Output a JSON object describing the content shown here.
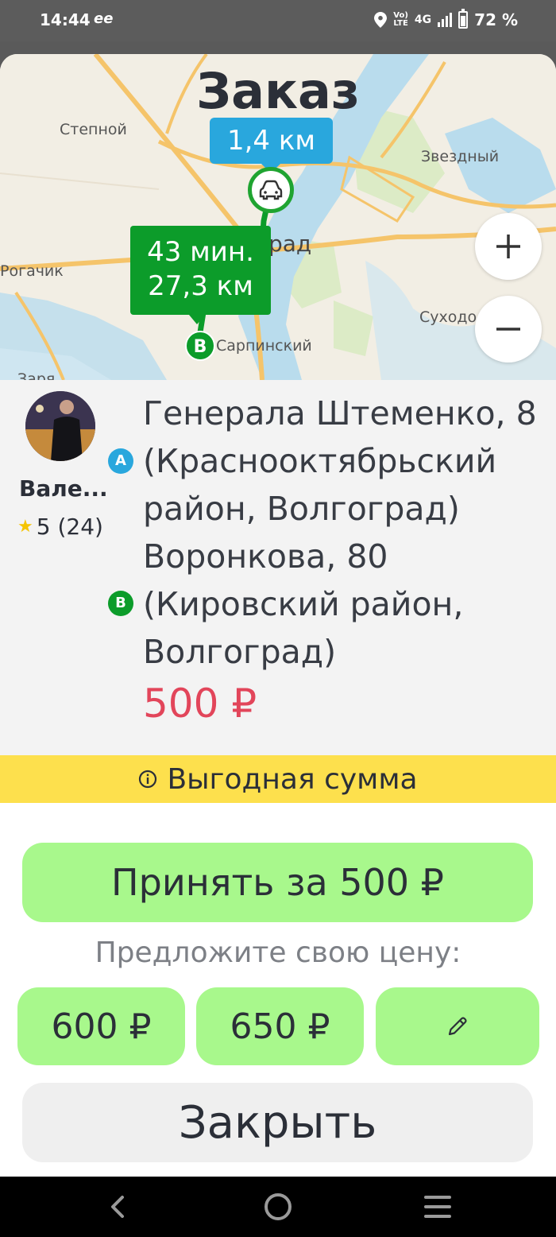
{
  "status_bar": {
    "time": "14:44",
    "app_indicator": "ee",
    "volte_top": "Vo)",
    "volte_bottom": "LTE",
    "network": "4G",
    "battery_percent": "72 %",
    "icons": [
      "location-icon",
      "volte-icon",
      "signal-icon",
      "battery-icon"
    ]
  },
  "order": {
    "title": "Заказ",
    "pickup_distance": "1,4 км",
    "trip_time": "43 мин.",
    "trip_distance": "27,3 км",
    "marker_a": "A",
    "marker_b": "B"
  },
  "map": {
    "labels": {
      "stepnoy": "Степной",
      "zvezdny": "Звездный",
      "rogachik": "Рогачик",
      "grad": "рад",
      "sukhodol": "Суходол",
      "sarpinsky": "Сарпинский",
      "zarya": "Заря"
    },
    "zoom_in_icon": "plus-icon",
    "zoom_out_icon": "minus-icon"
  },
  "driver": {
    "name": "Вале...",
    "rating": "5 (24)"
  },
  "route": {
    "from": "Генерала Штеменко, 8 (Краснооктябрьский район, Волгоград)",
    "to": "Воронкова, 80 (Кировский район, Волгоград)",
    "price": "500 ₽"
  },
  "promo": {
    "text": "Выгодная сумма",
    "icon": "info-icon"
  },
  "actions": {
    "accept_label": "Принять за 500 ₽",
    "offer_label": "Предложите свою цену:",
    "offers": [
      "600 ₽",
      "650 ₽"
    ],
    "edit_icon": "pencil-icon",
    "close_label": "Закрыть"
  },
  "colors": {
    "accent_green": "#a8f88c",
    "route_green": "#0c9c2a",
    "pickup_blue": "#29a7dd",
    "price_red": "#e2455a",
    "promo_yellow": "#fde04d"
  },
  "nav": {
    "icons": [
      "back-icon",
      "home-icon",
      "menu-icon"
    ]
  }
}
